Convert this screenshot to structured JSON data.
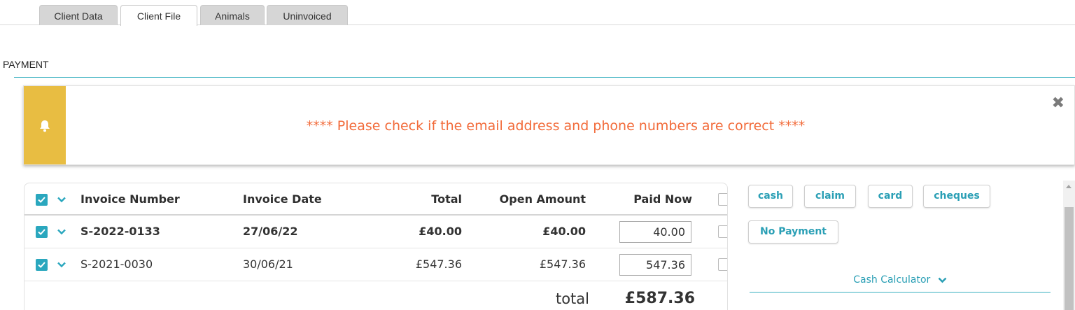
{
  "tabs": [
    "Client Data",
    "Client File",
    "Animals",
    "Uninvoiced"
  ],
  "active_tab": "Client File",
  "section_title": "PAYMENT",
  "alert": {
    "message": "**** Please check if the email address and phone numbers are correct ****",
    "icon": "bell-icon",
    "close_symbol": "✖"
  },
  "table": {
    "headers": {
      "invoice_number": "Invoice Number",
      "invoice_date": "Invoice Date",
      "total": "Total",
      "open_amount": "Open Amount",
      "paid_now": "Paid Now"
    },
    "rows": [
      {
        "invoice_number": "S-2022-0133",
        "invoice_date": "27/06/22",
        "total": "£40.00",
        "open_amount": "£40.00",
        "paid_now": "40.00",
        "checked": true
      },
      {
        "invoice_number": "S-2021-0030",
        "invoice_date": "30/06/21",
        "total": "£547.36",
        "open_amount": "£547.36",
        "paid_now": "547.36",
        "checked": true
      }
    ],
    "total_label": "total",
    "total_value": "£587.36"
  },
  "payment_buttons": {
    "cash": "cash",
    "claim": "claim",
    "card": "card",
    "cheques": "cheques",
    "no_payment": "No Payment"
  },
  "cash_calculator_label": "Cash Calculator",
  "colors": {
    "accent": "#2aa7be",
    "alert_side": "#e8bd42",
    "alert_text": "#f26b3a"
  }
}
